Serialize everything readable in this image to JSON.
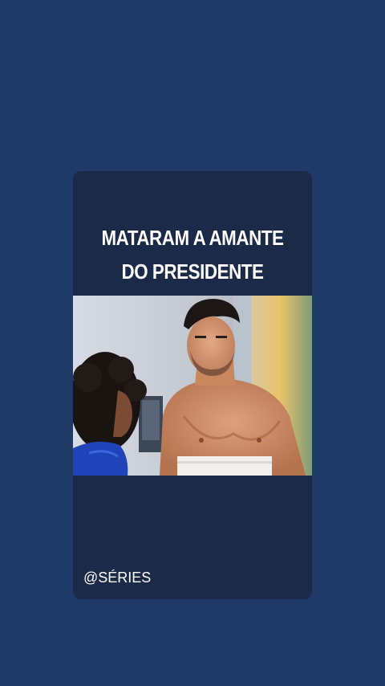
{
  "story": {
    "headline_line1": "MATARAM A AMANTE",
    "headline_line2": "DO PRESIDENTE",
    "handle": "@SÉRIES"
  },
  "colors": {
    "background": "#203a67",
    "card": "#1b2a48",
    "text": "#ffffff"
  }
}
